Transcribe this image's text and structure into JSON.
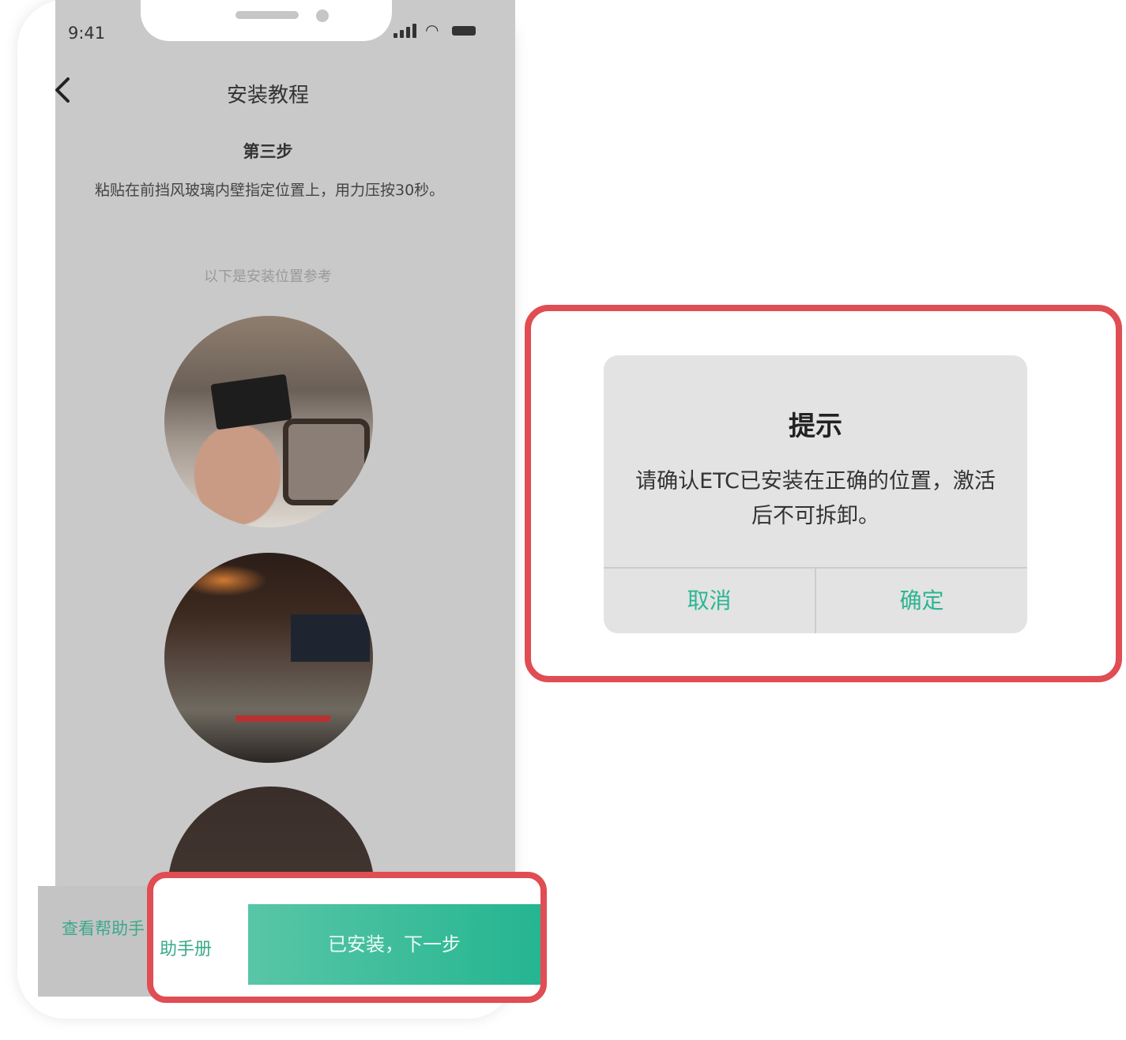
{
  "status_bar": {
    "time": "9:41"
  },
  "header": {
    "title": "安装教程"
  },
  "step": {
    "title": "第三步",
    "description": "粘贴在前挡风玻璃内壁指定位置上，用力压按30秒。"
  },
  "reference": {
    "caption": "以下是安装位置参考"
  },
  "footer": {
    "help_link": "查看帮助手",
    "help_link_tail": "助手册",
    "next_button": "已安装，下一步"
  },
  "dialog": {
    "title": "提示",
    "message": "请确认ETC已安装在正确的位置，激活后不可拆卸。",
    "cancel": "取消",
    "confirm": "确定"
  },
  "colors": {
    "accent": "#2bb592",
    "highlight": "#e04d52"
  }
}
